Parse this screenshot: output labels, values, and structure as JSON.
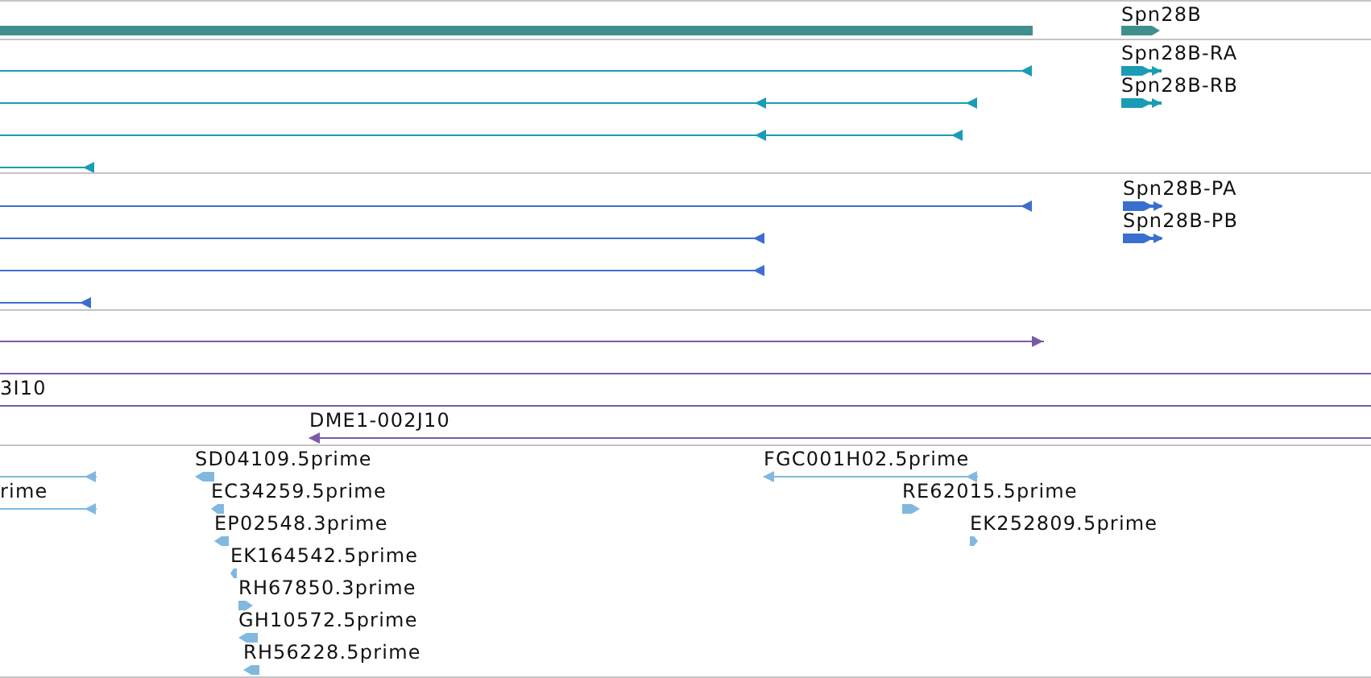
{
  "tracks": [
    {
      "color": "#3f8f8f",
      "features": [
        {
          "kind": "bar"
        },
        {
          "kind": "block",
          "reverse": false,
          "label": "Spn28B"
        }
      ]
    },
    {
      "color": "#1a9cb5",
      "features": [
        {
          "kind": "line",
          "reverse": true
        },
        {
          "kind": "line",
          "reverse": true
        },
        {
          "kind": "line",
          "reverse": true
        },
        {
          "kind": "line",
          "reverse": true
        },
        {
          "kind": "chevron",
          "reverse": false,
          "label": "Spn28B-RA"
        },
        {
          "kind": "chevron",
          "reverse": false,
          "label": "Spn28B-RB"
        }
      ]
    },
    {
      "color": "#3a6fcf",
      "features": [
        {
          "kind": "line",
          "reverse": true
        },
        {
          "kind": "line",
          "reverse": true
        },
        {
          "kind": "line",
          "reverse": true
        },
        {
          "kind": "line",
          "reverse": true
        },
        {
          "kind": "chevron",
          "reverse": false,
          "label": "Spn28B-PA"
        },
        {
          "kind": "chevron",
          "reverse": false,
          "label": "Spn28B-PB"
        }
      ]
    },
    {
      "color": "#7a5aa8",
      "features": [
        {
          "kind": "line",
          "reverse": false
        },
        {
          "kind": "rule"
        },
        {
          "kind": "rule",
          "label": "3I10"
        },
        {
          "kind": "line",
          "reverse": true,
          "label": "DME1-002J10"
        }
      ]
    },
    {
      "color": "#80b8e0",
      "features": [
        {
          "kind": "line",
          "reverse": true
        },
        {
          "kind": "line",
          "reverse": true,
          "label": "rime"
        },
        {
          "kind": "block",
          "reverse": true,
          "label": "SD04109.5prime"
        },
        {
          "kind": "line",
          "reverse": true,
          "label": "FGC001H02.5prime"
        },
        {
          "kind": "block",
          "reverse": true,
          "label": "EC34259.5prime"
        },
        {
          "kind": "block",
          "reverse": false,
          "label": "RE62015.5prime"
        },
        {
          "kind": "block",
          "reverse": true,
          "label": "EP02548.3prime"
        },
        {
          "kind": "block",
          "reverse": false,
          "label": "EK252809.5prime"
        },
        {
          "kind": "block",
          "reverse": true,
          "label": "EK164542.5prime"
        },
        {
          "kind": "block",
          "reverse": false,
          "label": "RH67850.3prime"
        },
        {
          "kind": "block",
          "reverse": true,
          "label": "GH10572.5prime"
        },
        {
          "kind": "block",
          "reverse": true,
          "label": "RH56228.5prime"
        }
      ]
    }
  ]
}
